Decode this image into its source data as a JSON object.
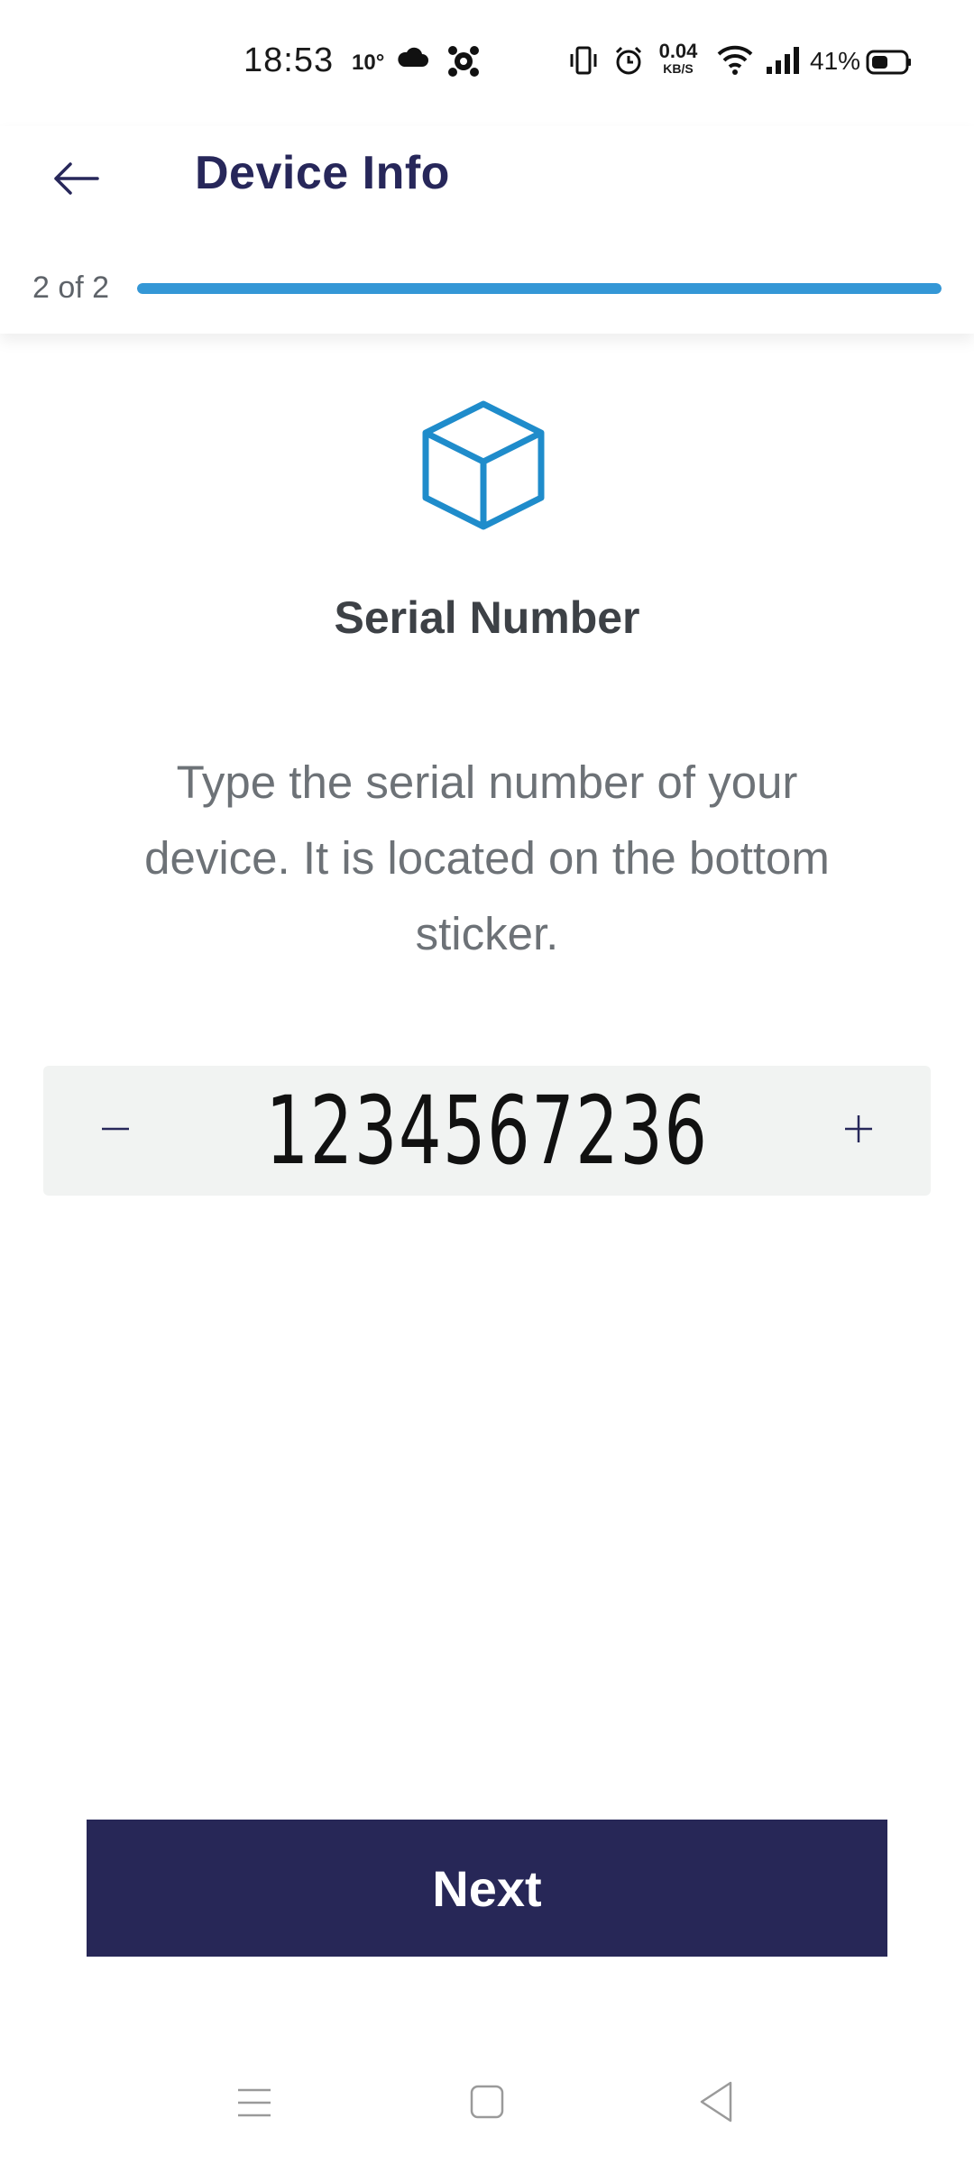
{
  "status_bar": {
    "time": "18:53",
    "temperature": "10°",
    "network_speed_value": "0.04",
    "network_speed_unit": "KB/S",
    "battery_percent": "41%",
    "icons": [
      "cloud-icon",
      "app-notification-icon",
      "vibrate-icon",
      "alarm-icon",
      "wifi-icon",
      "signal-icon",
      "battery-icon"
    ]
  },
  "header": {
    "back_icon": "arrow-left-icon",
    "title": "Device Info",
    "step_label": "2 of 2",
    "progress": 1.0,
    "progress_color": "#3497d6"
  },
  "main": {
    "icon": "cube-icon",
    "section_title": "Serial Number",
    "instructions": "Type the serial number of your device. It is located on the bottom sticker.",
    "serial_value": "1234567236",
    "minus_icon": "minus-icon",
    "plus_icon": "plus-icon"
  },
  "footer": {
    "next_label": "Next",
    "button_color": "#272757"
  },
  "nav_bar": {
    "icons": [
      "recent-apps-icon",
      "home-icon",
      "back-triangle-icon"
    ]
  }
}
